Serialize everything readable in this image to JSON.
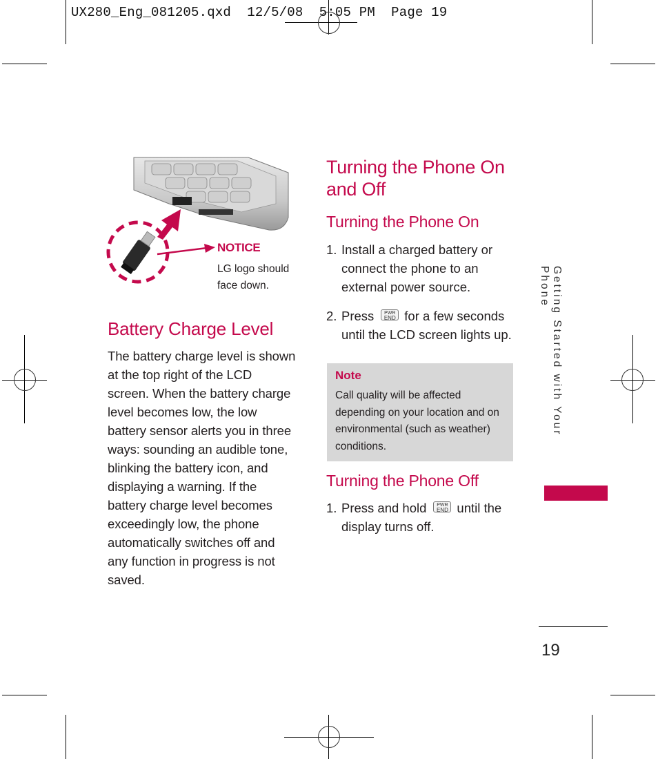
{
  "print_slug": {
    "file": "UX280_Eng_081205.qxd",
    "date": "12/5/08",
    "time": "5:05 PM",
    "page_label": "Page 19"
  },
  "figure": {
    "notice_title": "NOTICE",
    "notice_text": "LG logo should face down."
  },
  "battery": {
    "heading": "Battery Charge Level",
    "lines": [
      "The battery charge level is shown",
      "at the top right of the LCD",
      "screen. When the battery charge",
      "level becomes low, the low",
      "battery sensor alerts you in three",
      "ways: sounding an audible tone,",
      "blinking the battery icon, and",
      "displaying a warning. If the",
      "battery charge level becomes",
      "exceedingly low, the phone",
      "automatically switches off and",
      "any function in progress is not",
      "saved."
    ]
  },
  "turning": {
    "heading_line1": "Turning the Phone On",
    "heading_line2": "and Off",
    "on": {
      "heading": "Turning the Phone On",
      "steps": [
        {
          "num": "1.",
          "lines": [
            "Install a charged battery or",
            "connect the phone to an",
            "external power source."
          ]
        },
        {
          "num": "2.",
          "before": "Press",
          "after": "for a few seconds",
          "line2": "until the LCD screen lights up."
        }
      ]
    },
    "note": {
      "title": "Note",
      "lines": [
        "Call quality will be affected",
        "depending on your location and on",
        "environmental (such as weather)",
        "conditions."
      ]
    },
    "off": {
      "heading": "Turning the Phone Off",
      "steps": [
        {
          "num": "1.",
          "before": "Press and hold",
          "after": "until the",
          "line2": "display turns off."
        }
      ]
    }
  },
  "key_icon": {
    "top": "PWR",
    "bottom": "END",
    "icon": "pwr-end-key-icon"
  },
  "sidebar": {
    "section_title": "Getting Started with Your Phone"
  },
  "page_number": "19",
  "colors": {
    "accent": "#c4094c",
    "note_bg": "#d7d7d7",
    "text": "#231f20"
  }
}
